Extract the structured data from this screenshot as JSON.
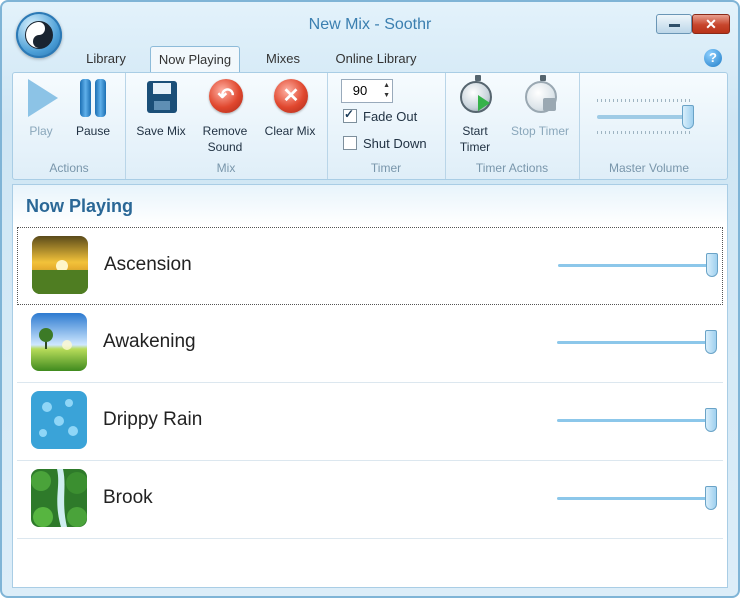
{
  "window": {
    "title": "New Mix - Soothr",
    "min_label": "",
    "close_label": "✕"
  },
  "tabs": [
    {
      "label": "Library"
    },
    {
      "label": "Now Playing"
    },
    {
      "label": "Mixes"
    },
    {
      "label": "Online Library"
    }
  ],
  "active_tab": "Now Playing",
  "help_icon": "?",
  "ribbon": {
    "actions": {
      "play": "Play",
      "pause": "Pause",
      "group": "Actions"
    },
    "mix": {
      "save": "Save Mix",
      "remove_line1": "Remove",
      "remove_line2": "Sound",
      "clear": "Clear Mix",
      "group": "Mix"
    },
    "timer": {
      "minutes": "90",
      "fade_out": "Fade Out",
      "fade_out_checked": true,
      "shut_down": "Shut Down",
      "shut_down_checked": false,
      "group": "Timer"
    },
    "timer_actions": {
      "start_line1": "Start",
      "start_line2": "Timer",
      "stop": "Stop Timer",
      "group": "Timer Actions"
    },
    "master_volume": {
      "group": "Master Volume",
      "level": 0.95
    }
  },
  "now_playing": {
    "title": "Now Playing",
    "sounds": [
      {
        "name": "Ascension",
        "volume": 1.0,
        "image": "sunrise-field"
      },
      {
        "name": "Awakening",
        "volume": 1.0,
        "image": "tree-meadow"
      },
      {
        "name": "Drippy Rain",
        "volume": 1.0,
        "image": "rain-drops"
      },
      {
        "name": "Brook",
        "volume": 1.0,
        "image": "forest-brook"
      }
    ]
  },
  "colors": {
    "accent": "#2a6796",
    "title_text": "#3b7fb0",
    "track": "#8cc7ea"
  }
}
